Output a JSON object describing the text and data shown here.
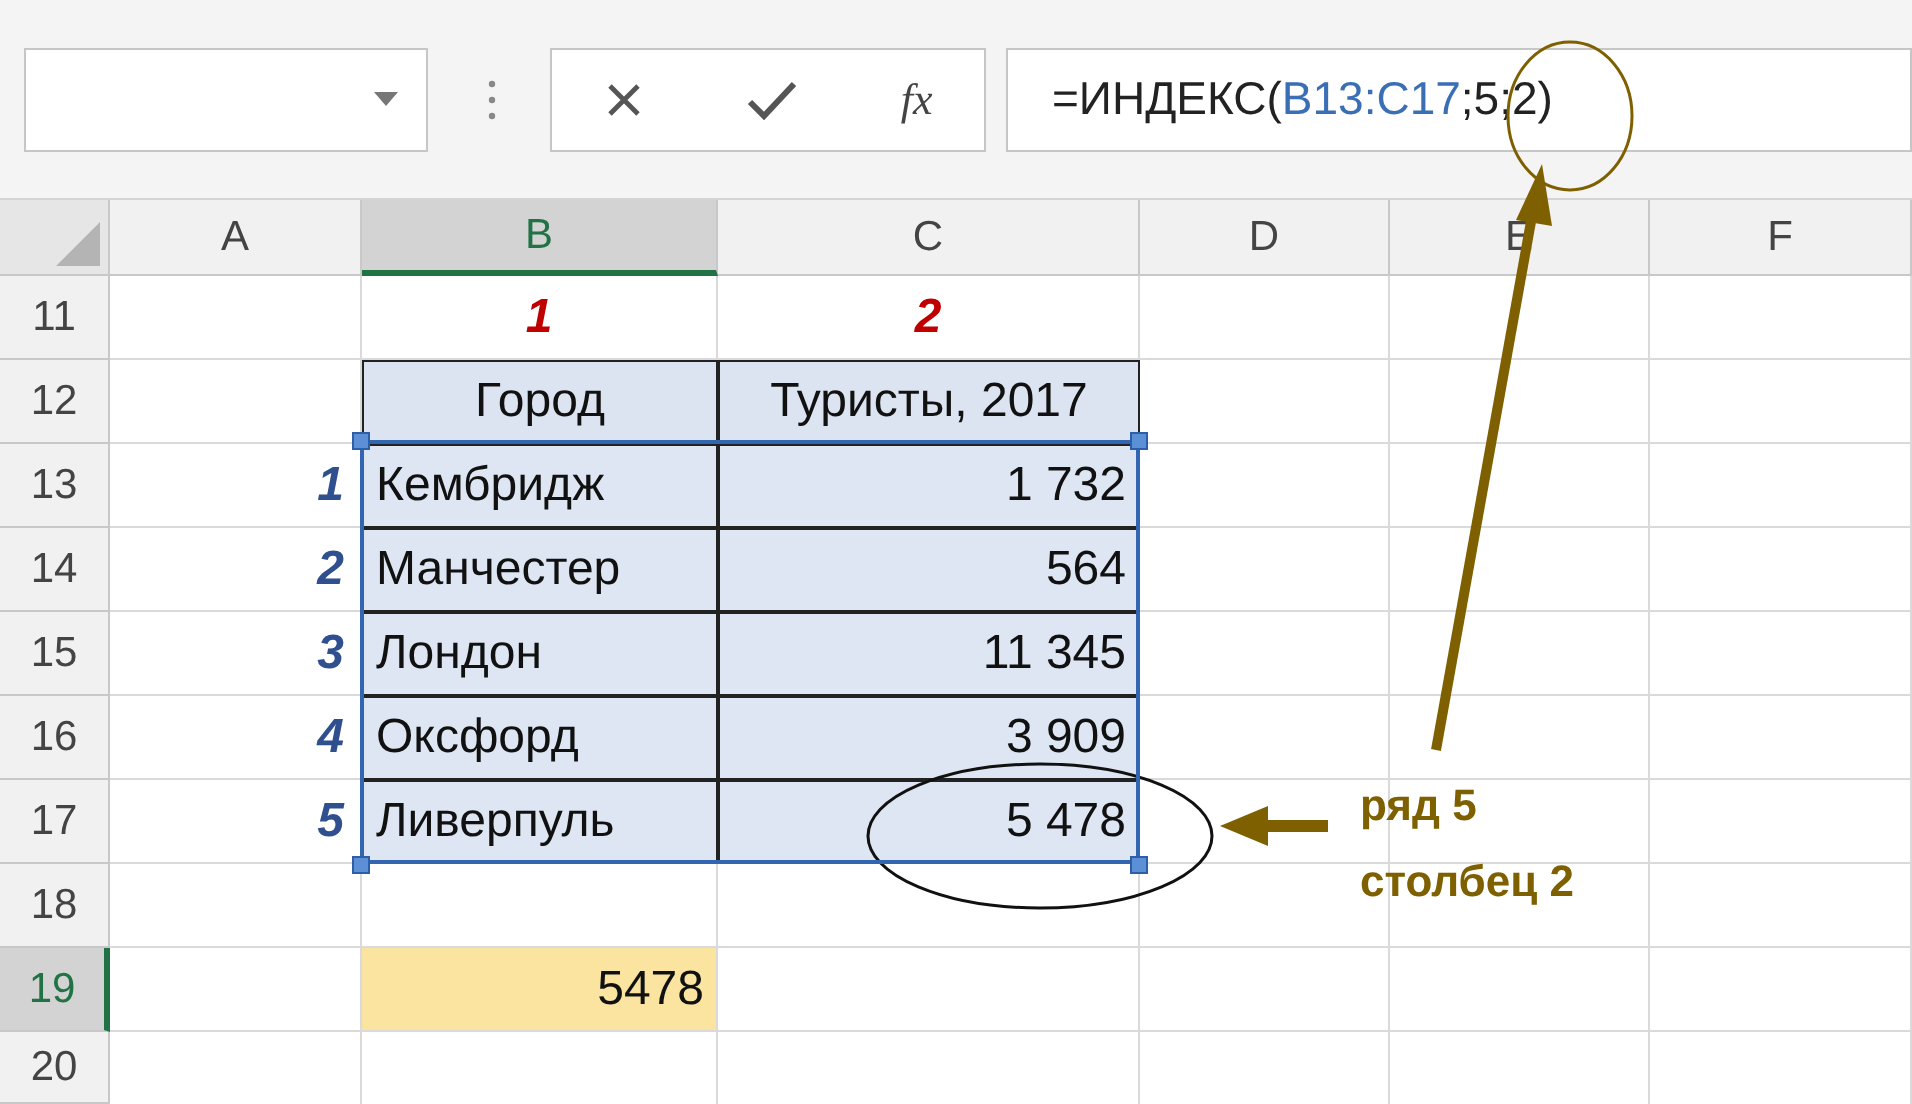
{
  "formula_bar": {
    "function_label": "fx",
    "formula": [
      {
        "text": "=ИНДЕКС(",
        "kind": "plain"
      },
      {
        "text": "B13:C17",
        "kind": "reference"
      },
      {
        "text": ";5;2)",
        "kind": "plain"
      }
    ]
  },
  "columns": [
    {
      "label": "A",
      "selected": false
    },
    {
      "label": "B",
      "selected": true
    },
    {
      "label": "C",
      "selected": false
    },
    {
      "label": "D",
      "selected": false
    },
    {
      "label": "E",
      "selected": false
    },
    {
      "label": "F",
      "selected": false
    }
  ],
  "rows": [
    {
      "number": "11",
      "selected": false,
      "cell_b": {
        "text": "1",
        "kind": "col_index"
      },
      "cell_c": {
        "text": "2",
        "kind": "col_index"
      }
    },
    {
      "number": "12",
      "selected": false,
      "cell_b": {
        "text": "Город",
        "kind": "header"
      },
      "cell_c": {
        "text": "Туристы, 2017",
        "kind": "header"
      }
    },
    {
      "number": "13",
      "selected": false,
      "cell_a": {
        "text": "1",
        "kind": "row_index"
      },
      "cell_b": {
        "text": "Кембридж",
        "kind": "data_text"
      },
      "cell_c": {
        "text": "1 732",
        "kind": "data_number"
      }
    },
    {
      "number": "14",
      "selected": false,
      "cell_a": {
        "text": "2",
        "kind": "row_index"
      },
      "cell_b": {
        "text": "Манчестер",
        "kind": "data_text"
      },
      "cell_c": {
        "text": "564",
        "kind": "data_number"
      }
    },
    {
      "number": "15",
      "selected": false,
      "cell_a": {
        "text": "3",
        "kind": "row_index"
      },
      "cell_b": {
        "text": "Лондон",
        "kind": "data_text"
      },
      "cell_c": {
        "text": "11 345",
        "kind": "data_number"
      }
    },
    {
      "number": "16",
      "selected": false,
      "cell_a": {
        "text": "4",
        "kind": "row_index"
      },
      "cell_b": {
        "text": "Оксфорд",
        "kind": "data_text"
      },
      "cell_c": {
        "text": "3 909",
        "kind": "data_number"
      }
    },
    {
      "number": "17",
      "selected": false,
      "cell_a": {
        "text": "5",
        "kind": "row_index"
      },
      "cell_b": {
        "text": "Ливерпуль",
        "kind": "data_text"
      },
      "cell_c": {
        "text": "5 478",
        "kind": "data_number"
      }
    },
    {
      "number": "18",
      "selected": false
    },
    {
      "number": "19",
      "selected": true,
      "cell_b": {
        "text": "5478",
        "kind": "result"
      }
    },
    {
      "number": "20",
      "selected": false
    }
  ],
  "annotation": [
    "ряд 5",
    "столбец 2"
  ]
}
